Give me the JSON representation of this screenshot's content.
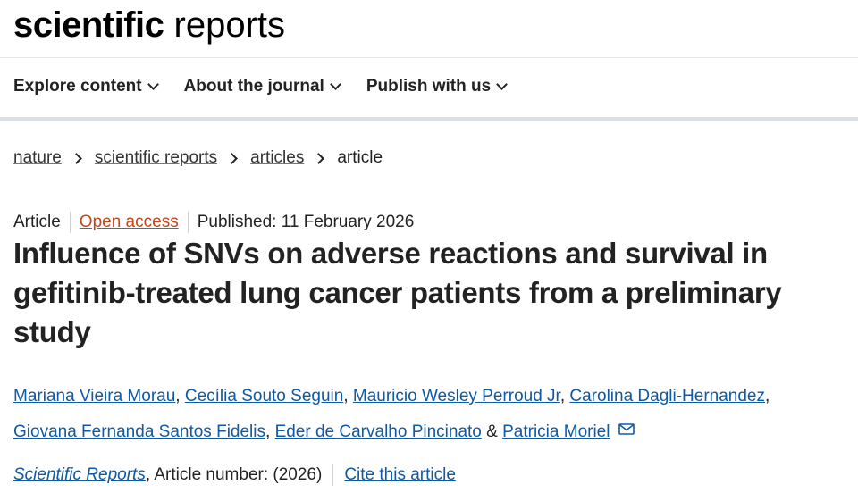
{
  "logo": {
    "strong": "scientific",
    "light": "reports"
  },
  "nav": [
    {
      "label": "Explore content"
    },
    {
      "label": "About the journal"
    },
    {
      "label": "Publish with us"
    }
  ],
  "breadcrumb": {
    "items": [
      "nature",
      "scientific reports",
      "articles"
    ],
    "current": "article"
  },
  "meta": {
    "type": "Article",
    "access": "Open access",
    "published": "Published: 11 February 2026"
  },
  "title": "Influence of SNVs on adverse reactions and survival in gefitinib-treated lung cancer patients from a preliminary study",
  "authors": [
    "Mariana Vieira Morau",
    "Cecília Souto Seguin",
    "Mauricio Wesley Perroud Jr",
    "Carolina Dagli-Hernandez",
    "Giovana Fernanda Santos Fidelis",
    "Eder de Carvalho Pincinato",
    "Patricia Moriel"
  ],
  "citation": {
    "journal": "Scientific Reports",
    "article_number": ", Article number:  (2026)",
    "cite_label": "Cite this article"
  },
  "colors": {
    "link": "#0e5aa7",
    "open_access": "#c0481a",
    "nav_bar": "#dadfe3"
  }
}
